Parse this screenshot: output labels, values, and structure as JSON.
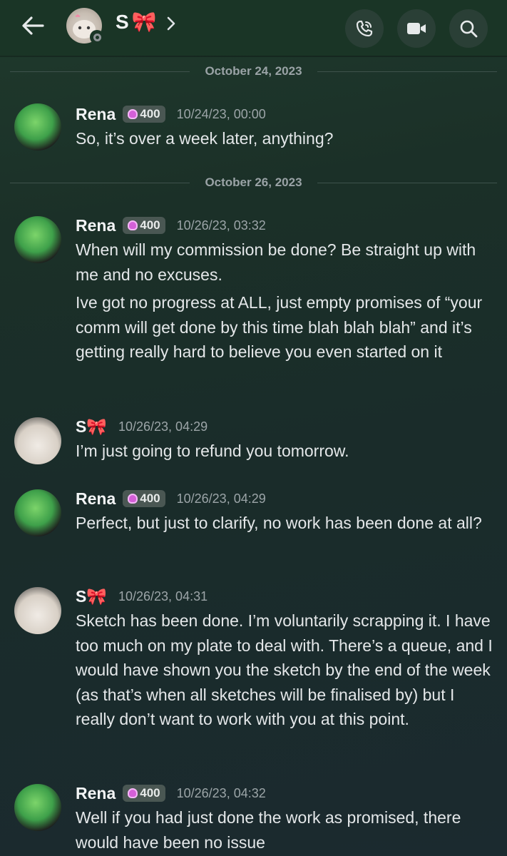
{
  "header": {
    "contact_name": "S",
    "contact_emoji": "🎀",
    "icons": [
      "back-arrow-icon",
      "phone-icon",
      "video-camera-icon",
      "search-icon"
    ]
  },
  "dividers": [
    "October 24, 2023",
    "October 26, 2023"
  ],
  "badge_text": "400",
  "messages": [
    {
      "author": "Rena",
      "timestamp": "10/24/23, 00:00",
      "paragraphs": [
        "So, it’s over a week later, anything?"
      ]
    },
    {
      "author": "Rena",
      "timestamp": "10/26/23, 03:32",
      "paragraphs": [
        "When will my commission be done? Be straight up with me and no excuses.",
        "Ive got no progress at ALL, just empty promises of “your comm will get done by this time blah blah blah” and it’s getting really hard to believe you even started on it"
      ]
    },
    {
      "author": "S",
      "timestamp": "10/26/23, 04:29",
      "paragraphs": [
        "I’m just going to refund you tomorrow."
      ]
    },
    {
      "author": "Rena",
      "timestamp": "10/26/23, 04:29",
      "paragraphs": [
        "Perfect, but just to clarify, no work has been done at all?"
      ]
    },
    {
      "author": "S",
      "timestamp": "10/26/23, 04:31",
      "paragraphs": [
        "Sketch has been done. I’m voluntarily scrapping it. I have too much on my plate to deal with. There’s a queue, and I would have shown you the sketch by the end of the week (as that’s when all sketches will be finalised by) but I really don’t want to work with you at this point."
      ]
    },
    {
      "author": "Rena",
      "timestamp": "10/26/23, 04:32",
      "paragraphs": [
        "Well if you had just done the work as promised, there would have been no issue"
      ]
    }
  ]
}
